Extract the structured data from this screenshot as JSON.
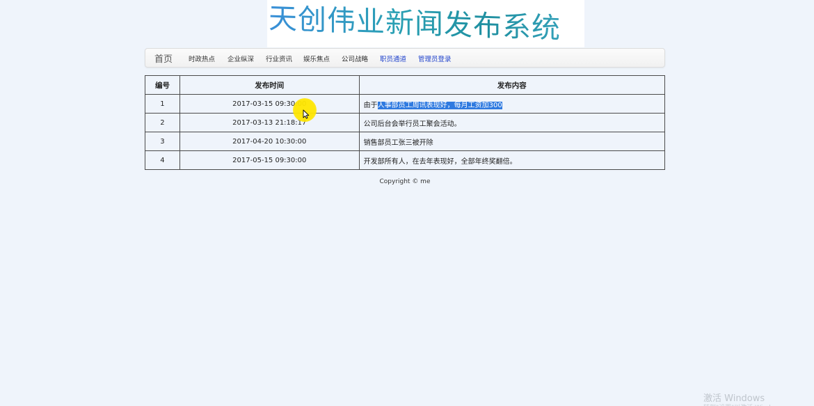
{
  "banner": {
    "title": "天创伟业新闻发布系统"
  },
  "nav": {
    "brand": "首页",
    "items": [
      {
        "label": "时政热点"
      },
      {
        "label": "企业纵深"
      },
      {
        "label": "行业资讯"
      },
      {
        "label": "娱乐焦点"
      },
      {
        "label": "公司战略"
      },
      {
        "label": "职员通道"
      },
      {
        "label": "管理员登录"
      }
    ]
  },
  "table": {
    "headers": {
      "id": "编号",
      "time": "发布时间",
      "content": "发布内容"
    },
    "rows": [
      {
        "id": "1",
        "time": "2017-03-15 09:30:00",
        "content_prefix": "由于",
        "content_selected": "人事部员工周讯表现好，每月工资加300"
      },
      {
        "id": "2",
        "time": "2017-03-13 21:18:17",
        "content": "公司后台会举行员工聚会活动。"
      },
      {
        "id": "3",
        "time": "2017-04-20 10:30:00",
        "content": "销售部员工张三被开除"
      },
      {
        "id": "4",
        "time": "2017-05-15 09:30:00",
        "content": "开发部所有人，在去年表现好，全部年终奖翻倍。"
      }
    ]
  },
  "footer": {
    "copyright": "Copyright © me"
  },
  "watermark": {
    "text": "激活 Windows"
  },
  "colors": {
    "background": "#eff4fb",
    "selection": "#2f7ae0",
    "nav_link_blue": "#2244cc",
    "cursor_highlight": "#ffe600"
  }
}
